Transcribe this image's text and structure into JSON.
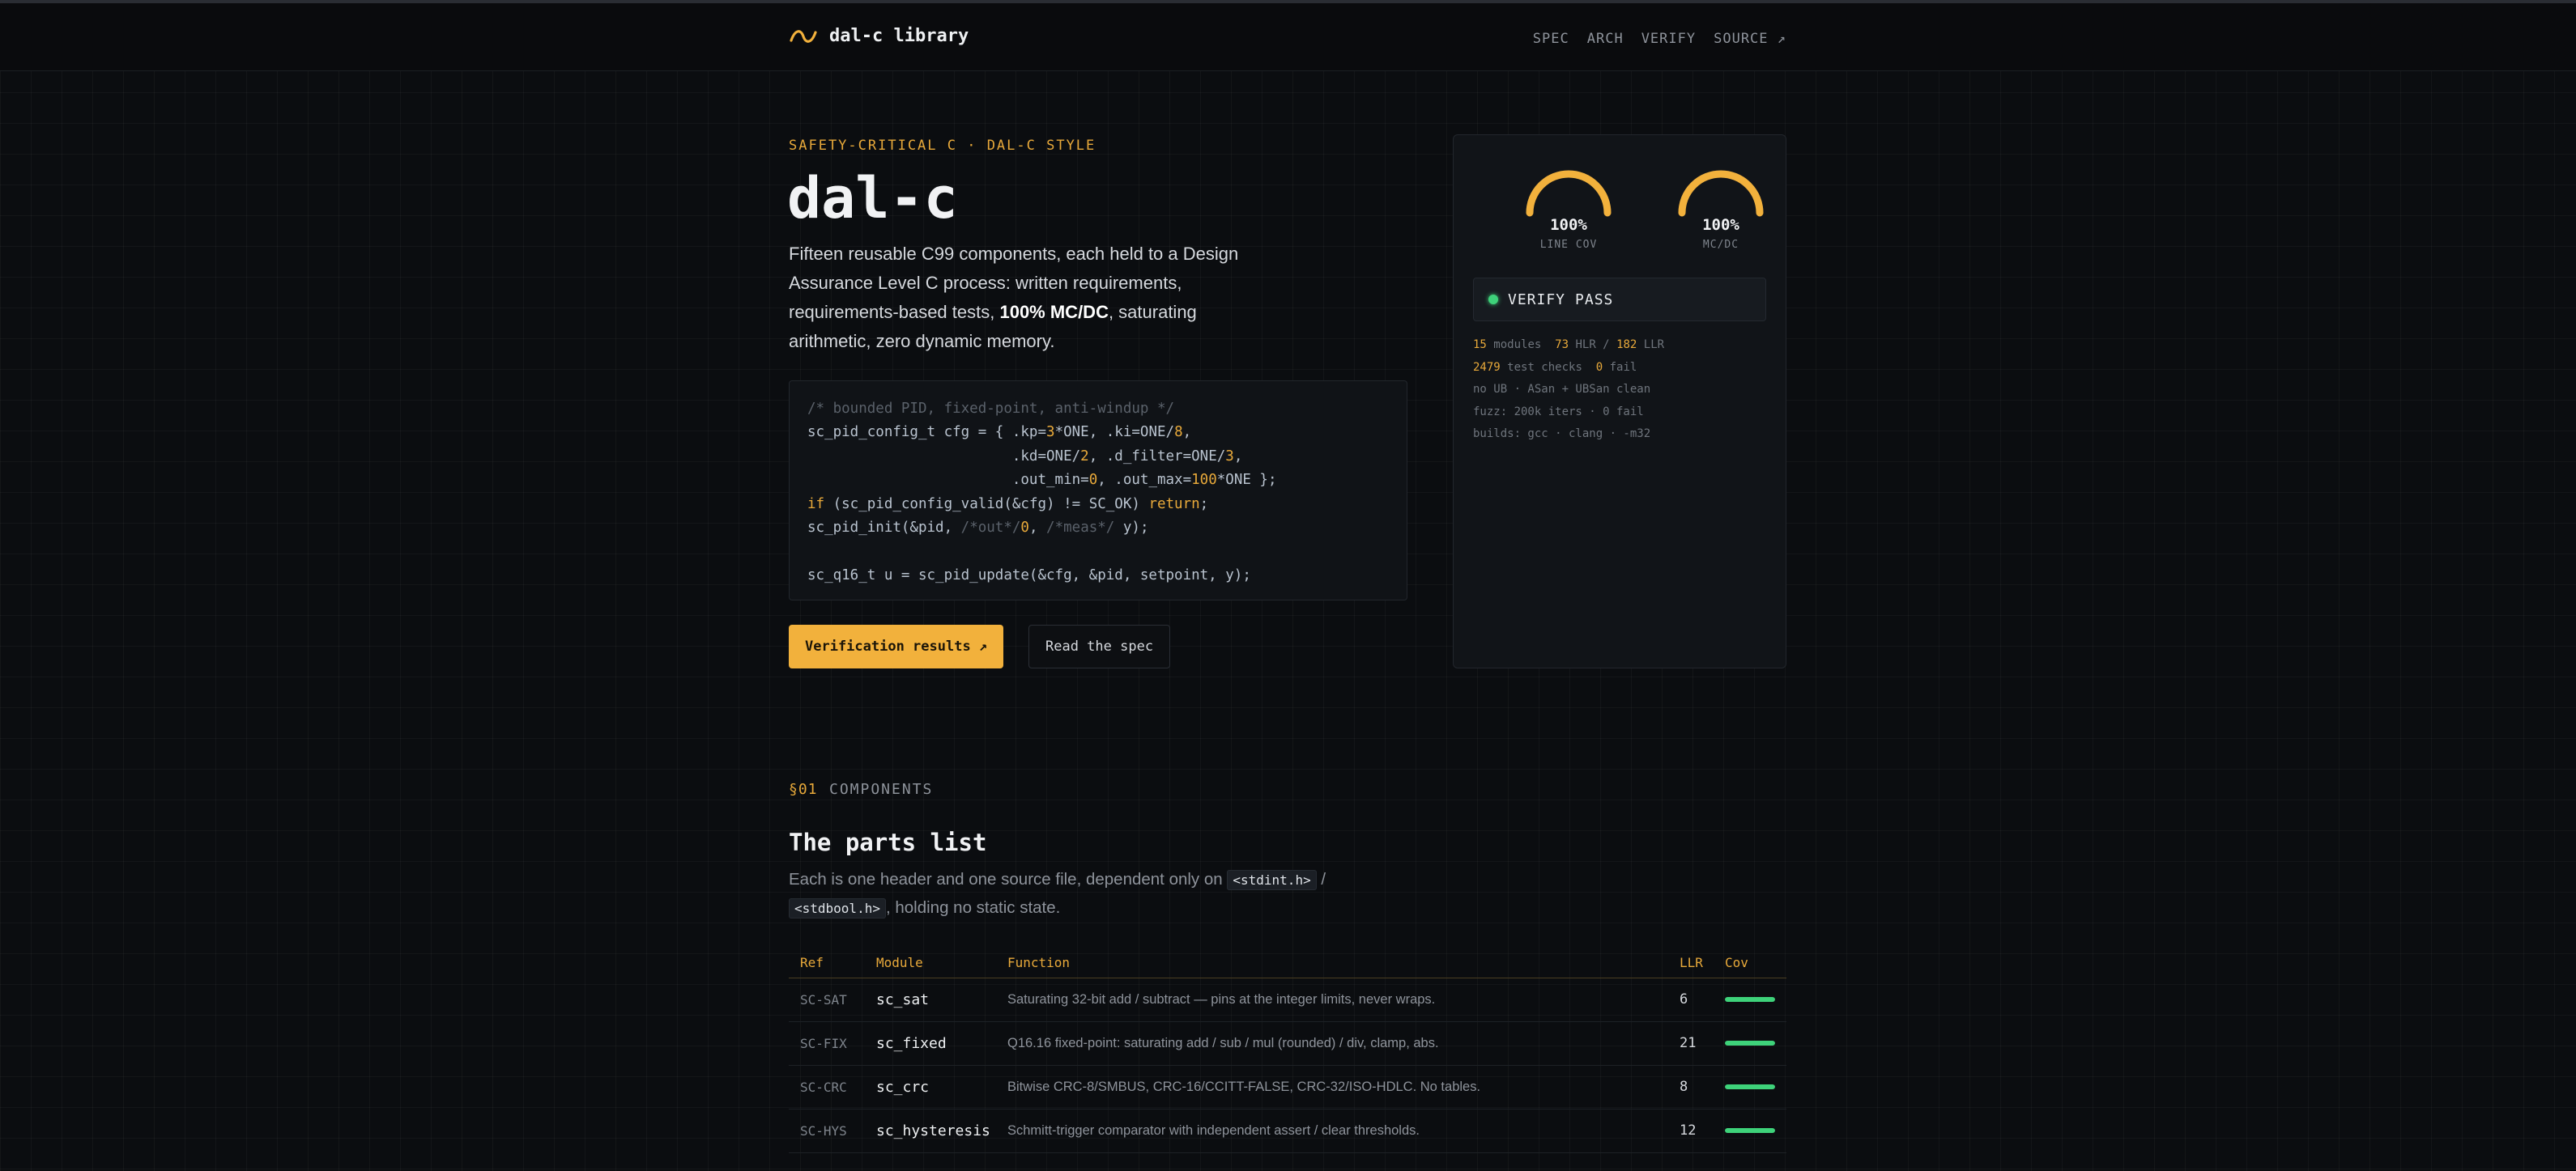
{
  "header": {
    "brand": "dal-c library",
    "nav": [
      "SPEC",
      "ARCH",
      "VERIFY",
      "SOURCE ↗"
    ]
  },
  "hero": {
    "eyebrow": "SAFETY-CRITICAL C · DAL-C STYLE",
    "title": "dal-c",
    "desc_before": "Fifteen reusable C99 components, each held to a Design Assurance Level C process: written requirements, requirements-based tests, ",
    "desc_bold": "100% MC/DC",
    "desc_after": ", saturating arithmetic, zero dynamic memory.",
    "code_lines": [
      "/* bounded PID, fixed-point, anti-windup */",
      "sc_pid_config_t cfg = { .kp=3*ONE, .ki=ONE/8,",
      "                        .kd=ONE/2, .d_filter=ONE/3,",
      "                        .out_min=0, .out_max=100*ONE };",
      "if (sc_pid_config_valid(&cfg) != SC_OK) return;",
      "sc_pid_init(&pid, /*out*/0, /*meas*/ y);",
      "",
      "sc_q16_t u = sc_pid_update(&cfg, &pid, setpoint, y);"
    ],
    "primary_button": "Verification results ↗",
    "secondary_button": "Read the spec"
  },
  "panel": {
    "gauges": [
      {
        "value_text": "100%",
        "label": "LINE COV",
        "fraction": 1.0
      },
      {
        "value_text": "100%",
        "label": "MC/DC",
        "fraction": 1.0
      }
    ],
    "verify_label": "VERIFY",
    "verify_status": "PASS",
    "stats": {
      "modules_count": "15",
      "modules_label": "modules",
      "hlr_count": "73",
      "hlr_label": "HLR /",
      "llr_count": "182",
      "llr_label": "LLR",
      "checks_count": "2479",
      "checks_label": "test checks",
      "fail_count": "0",
      "fail_label": "fail",
      "line3": "no UB · ASan + UBSan clean",
      "line4": "fuzz: 200k iters · 0 fail",
      "line5": "builds: gcc · clang · -m32"
    },
    "accent_color": "#f2b13c",
    "pass_color": "#3ed27a"
  },
  "components": {
    "section_number": "§01",
    "section_name": "COMPONENTS",
    "title": "The parts list",
    "desc_before": "Each is one header and one source file, dependent only on ",
    "code1": "<stdint.h>",
    "desc_mid": " / ",
    "code2": "<stdbool.h>",
    "desc_after": ", holding no static state.",
    "columns": [
      "Ref",
      "Module",
      "Function",
      "LLR",
      "Cov"
    ],
    "rows": [
      {
        "ref": "SC-SAT",
        "module": "sc_sat",
        "function": "Saturating 32-bit add / subtract — pins at the integer limits, never wraps.",
        "llr": "6",
        "cov": 1.0
      },
      {
        "ref": "SC-FIX",
        "module": "sc_fixed",
        "function": "Q16.16 fixed-point: saturating add / sub / mul (rounded) / div, clamp, abs.",
        "llr": "21",
        "cov": 1.0
      },
      {
        "ref": "SC-CRC",
        "module": "sc_crc",
        "function": "Bitwise CRC-8/SMBUS, CRC-16/CCITT-FALSE, CRC-32/ISO-HDLC. No tables.",
        "llr": "8",
        "cov": 1.0
      },
      {
        "ref": "SC-HYS",
        "module": "sc_hysteresis",
        "function": "Schmitt-trigger comparator with independent assert / clear thresholds.",
        "llr": "12",
        "cov": 1.0
      }
    ]
  }
}
